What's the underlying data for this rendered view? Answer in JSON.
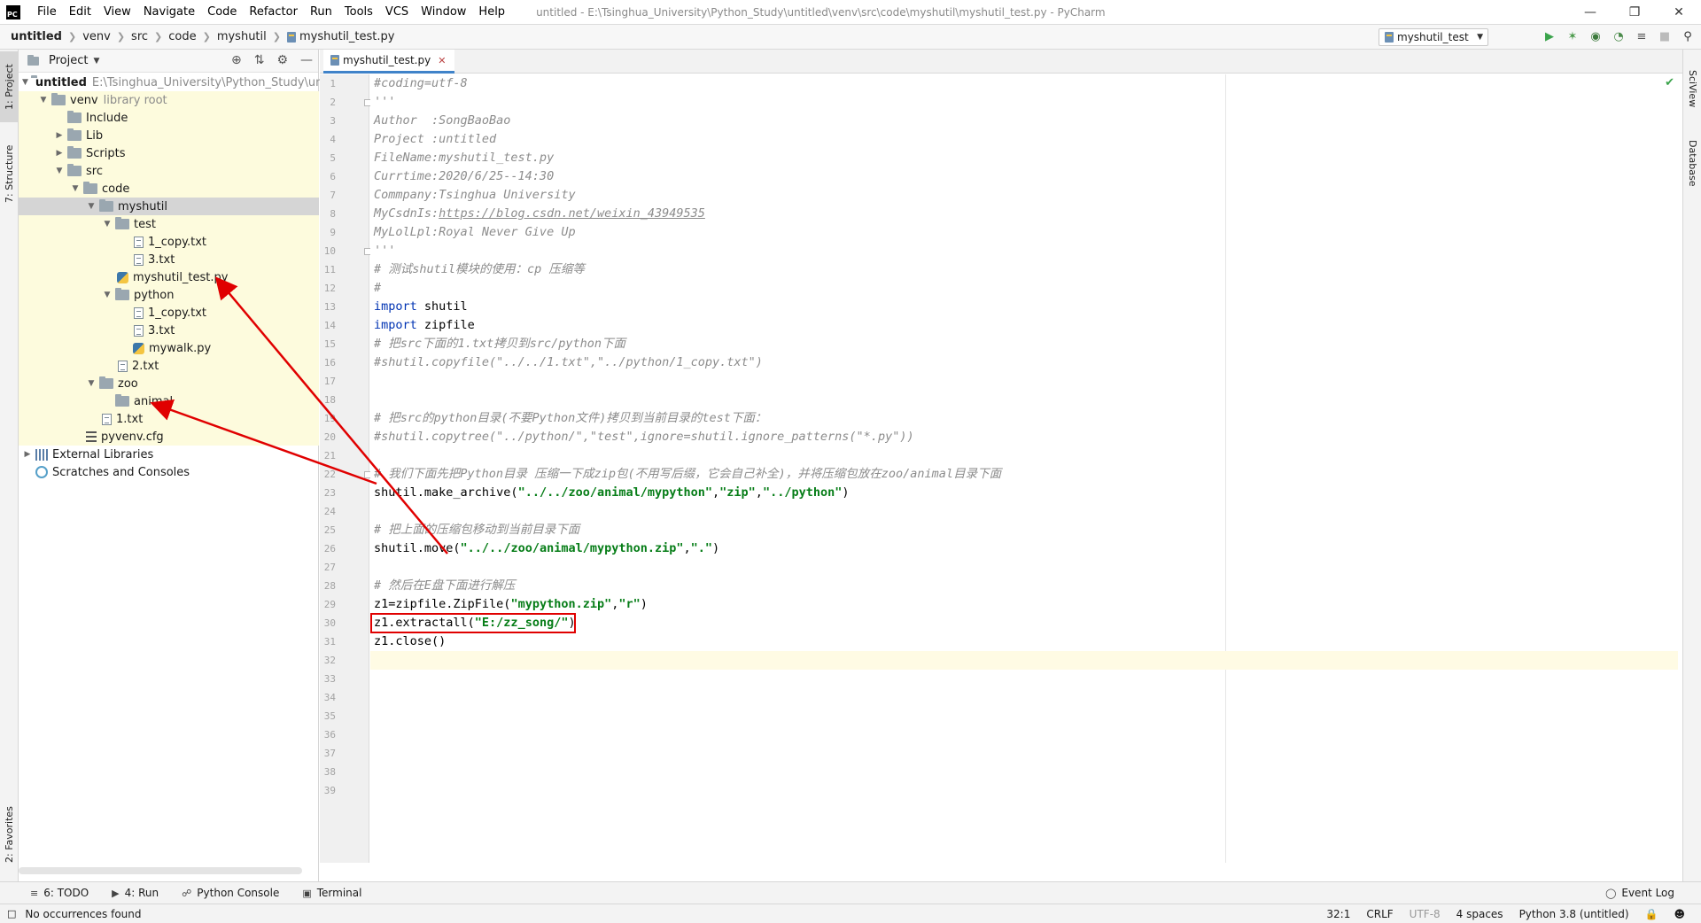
{
  "window": {
    "title": "untitled - E:\\Tsinghua_University\\Python_Study\\untitled\\venv\\src\\code\\myshutil\\myshutil_test.py - PyCharm",
    "logo": "PC",
    "controls": [
      "minimize-icon",
      "restore-icon",
      "close-icon"
    ]
  },
  "menu": [
    "File",
    "Edit",
    "View",
    "Navigate",
    "Code",
    "Refactor",
    "Run",
    "Tools",
    "VCS",
    "Window",
    "Help"
  ],
  "breadcrumb": [
    "untitled",
    "venv",
    "src",
    "code",
    "myshutil",
    "myshutil_test.py"
  ],
  "run_config": "myshutil_test",
  "toolbar_icons": [
    "run-icon",
    "debug-icon",
    "coverage-icon",
    "profile-icon",
    "concurrency-icon",
    "stop-icon",
    "search-icon"
  ],
  "left_tools": {
    "project": "1: Project",
    "structure": "7: Structure",
    "favorites": "2: Favorites"
  },
  "right_tools": {
    "sciview": "SciView",
    "database": "Database"
  },
  "project_panel": {
    "title": "Project",
    "root_name": "untitled",
    "root_path": "E:\\Tsinghua_University\\Python_Study\\untitled",
    "venv": "venv",
    "venv_note": "library root",
    "include": "Include",
    "lib": "Lib",
    "scripts": "Scripts",
    "src": "src",
    "code": "code",
    "myshutil": "myshutil",
    "test": "test",
    "test_copy": "1_copy.txt",
    "test_3": "3.txt",
    "myshutil_test": "myshutil_test.py",
    "python": "python",
    "py_copy": "1_copy.txt",
    "py_3": "3.txt",
    "mywalk": "mywalk.py",
    "txt2": "2.txt",
    "zoo": "zoo",
    "animal": "animal",
    "txt1": "1.txt",
    "pyvenv": "pyvenv.cfg",
    "ext_libs": "External Libraries",
    "scratches": "Scratches and Consoles"
  },
  "editor": {
    "tab": "myshutil_test.py",
    "line_count": 39,
    "lines": {
      "l1": "#coding=utf-8",
      "l2": "'''",
      "l3": "Author  :SongBaoBao",
      "l4": "Project :untitled",
      "l5": "FileName:myshutil_test.py",
      "l6": "Currtime:2020/6/25--14:30",
      "l7": "Commpany:Tsinghua University",
      "l8a": "MyCsdnIs:",
      "l8b": "https://blog.csdn.net/weixin_43949535",
      "l9": "MyLolLpl:Royal Never Give Up",
      "l10": "'''",
      "l11": "# 测试shutil模块的使用：cp 压缩等",
      "l12": "#",
      "l13a": "import",
      "l13b": " shutil",
      "l14a": "import",
      "l14b": " zipfile",
      "l15": "# 把src下面的1.txt拷贝到src/python下面",
      "l16": "#shutil.copyfile(\"../../1.txt\",\"../python/1_copy.txt\")",
      "l19": "# 把src的python目录(不要Python文件)拷贝到当前目录的test下面：",
      "l20": "#shutil.copytree(\"../python/\",\"test\",ignore=shutil.ignore_patterns(\"*.py\"))",
      "l22": "# 我们下面先把Python目录 压缩一下成zip包(不用写后缀，它会自己补全)，并将压缩包放在zoo/animal目录下面",
      "l23a": "shutil.make_archive(",
      "l23b": "\"../../zoo/animal/mypython\"",
      "l23c": ",",
      "l23d": "\"zip\"",
      "l23e": ",",
      "l23f": "\"../python\"",
      "l23g": ")",
      "l25": "# 把上面的压缩包移动到当前目录下面",
      "l26a": "shutil.move(",
      "l26b": "\"../../zoo/animal/mypython.zip\"",
      "l26c": ",",
      "l26d": "\".\"",
      "l26e": ")",
      "l28": "# 然后在E盘下面进行解压",
      "l29a": "z1=zipfile.ZipFile(",
      "l29b": "\"mypython.zip\"",
      "l29c": ",",
      "l29d": "\"r\"",
      "l29e": ")",
      "l30a": "z1.extractall(",
      "l30b": "\"E:/zz_song/\"",
      "l30c": ")",
      "l31": "z1.close()"
    }
  },
  "bottom_tabs": {
    "todo": "6: TODO",
    "run": "4: Run",
    "console": "Python Console",
    "terminal": "Terminal",
    "event_log": "Event Log"
  },
  "status_bar": {
    "message": "No occurrences found",
    "position": "32:1",
    "line_sep": "CRLF",
    "encoding": "UTF-8",
    "indent": "4 spaces",
    "interpreter": "Python 3.8 (untitled)"
  },
  "colors": {
    "annotation_red": "#e00000",
    "keyword": "#0033b3",
    "string": "#067d17",
    "comment": "#8c8c8c",
    "tree_highlight": "#fdfbdd"
  }
}
